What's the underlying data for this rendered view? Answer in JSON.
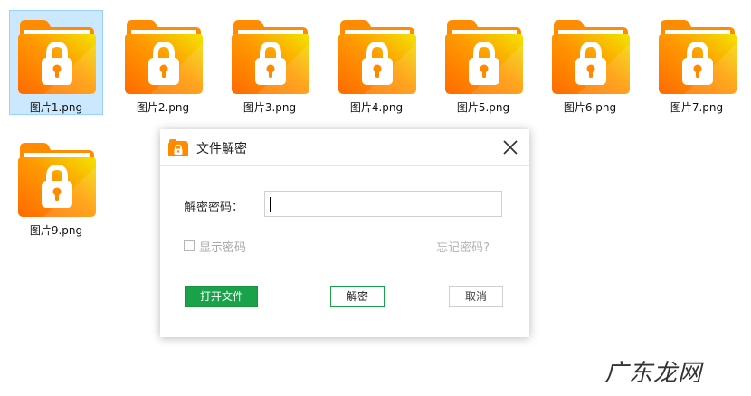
{
  "files": [
    {
      "name": "图片1.png",
      "selected": true
    },
    {
      "name": "图片2.png",
      "selected": false
    },
    {
      "name": "图片3.png",
      "selected": false
    },
    {
      "name": "图片4.png",
      "selected": false
    },
    {
      "name": "图片5.png",
      "selected": false
    },
    {
      "name": "图片6.png",
      "selected": false
    },
    {
      "name": "图片7.png",
      "selected": false
    },
    {
      "name": "图片9.png",
      "selected": false
    }
  ],
  "icons": {
    "file": "locked-folder-icon",
    "dialog_app": "locked-folder-icon",
    "close": "close-icon"
  },
  "dialog": {
    "title": "文件解密",
    "password_label": "解密密码：",
    "password_value": "",
    "show_password_label": "显示密码",
    "show_password_checked": false,
    "forgot_link": "忘记密码?",
    "open_button": "打开文件",
    "decrypt_button": "解密",
    "cancel_button": "取消"
  },
  "watermark": "广东龙网",
  "colors": {
    "selection_bg": "#cce8ff",
    "selection_border": "#99d1ff",
    "primary_green": "#1aa24a",
    "folder_orange": "#ff7a00",
    "folder_yellow": "#ffd400"
  }
}
